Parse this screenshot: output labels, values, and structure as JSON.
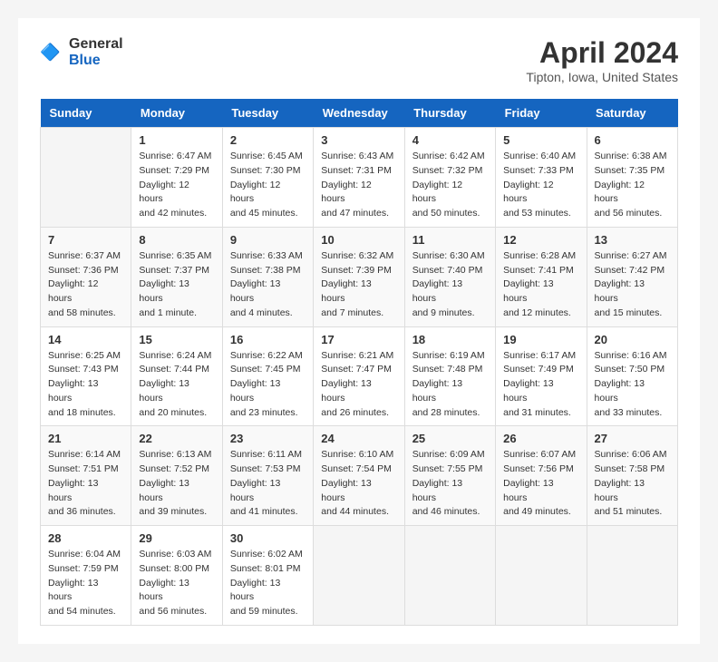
{
  "header": {
    "logo_general": "General",
    "logo_blue": "Blue",
    "title": "April 2024",
    "subtitle": "Tipton, Iowa, United States"
  },
  "days_of_week": [
    "Sunday",
    "Monday",
    "Tuesday",
    "Wednesday",
    "Thursday",
    "Friday",
    "Saturday"
  ],
  "weeks": [
    [
      {
        "day": "",
        "info": ""
      },
      {
        "day": "1",
        "info": "Sunrise: 6:47 AM\nSunset: 7:29 PM\nDaylight: 12 hours\nand 42 minutes."
      },
      {
        "day": "2",
        "info": "Sunrise: 6:45 AM\nSunset: 7:30 PM\nDaylight: 12 hours\nand 45 minutes."
      },
      {
        "day": "3",
        "info": "Sunrise: 6:43 AM\nSunset: 7:31 PM\nDaylight: 12 hours\nand 47 minutes."
      },
      {
        "day": "4",
        "info": "Sunrise: 6:42 AM\nSunset: 7:32 PM\nDaylight: 12 hours\nand 50 minutes."
      },
      {
        "day": "5",
        "info": "Sunrise: 6:40 AM\nSunset: 7:33 PM\nDaylight: 12 hours\nand 53 minutes."
      },
      {
        "day": "6",
        "info": "Sunrise: 6:38 AM\nSunset: 7:35 PM\nDaylight: 12 hours\nand 56 minutes."
      }
    ],
    [
      {
        "day": "7",
        "info": "Sunrise: 6:37 AM\nSunset: 7:36 PM\nDaylight: 12 hours\nand 58 minutes."
      },
      {
        "day": "8",
        "info": "Sunrise: 6:35 AM\nSunset: 7:37 PM\nDaylight: 13 hours\nand 1 minute."
      },
      {
        "day": "9",
        "info": "Sunrise: 6:33 AM\nSunset: 7:38 PM\nDaylight: 13 hours\nand 4 minutes."
      },
      {
        "day": "10",
        "info": "Sunrise: 6:32 AM\nSunset: 7:39 PM\nDaylight: 13 hours\nand 7 minutes."
      },
      {
        "day": "11",
        "info": "Sunrise: 6:30 AM\nSunset: 7:40 PM\nDaylight: 13 hours\nand 9 minutes."
      },
      {
        "day": "12",
        "info": "Sunrise: 6:28 AM\nSunset: 7:41 PM\nDaylight: 13 hours\nand 12 minutes."
      },
      {
        "day": "13",
        "info": "Sunrise: 6:27 AM\nSunset: 7:42 PM\nDaylight: 13 hours\nand 15 minutes."
      }
    ],
    [
      {
        "day": "14",
        "info": "Sunrise: 6:25 AM\nSunset: 7:43 PM\nDaylight: 13 hours\nand 18 minutes."
      },
      {
        "day": "15",
        "info": "Sunrise: 6:24 AM\nSunset: 7:44 PM\nDaylight: 13 hours\nand 20 minutes."
      },
      {
        "day": "16",
        "info": "Sunrise: 6:22 AM\nSunset: 7:45 PM\nDaylight: 13 hours\nand 23 minutes."
      },
      {
        "day": "17",
        "info": "Sunrise: 6:21 AM\nSunset: 7:47 PM\nDaylight: 13 hours\nand 26 minutes."
      },
      {
        "day": "18",
        "info": "Sunrise: 6:19 AM\nSunset: 7:48 PM\nDaylight: 13 hours\nand 28 minutes."
      },
      {
        "day": "19",
        "info": "Sunrise: 6:17 AM\nSunset: 7:49 PM\nDaylight: 13 hours\nand 31 minutes."
      },
      {
        "day": "20",
        "info": "Sunrise: 6:16 AM\nSunset: 7:50 PM\nDaylight: 13 hours\nand 33 minutes."
      }
    ],
    [
      {
        "day": "21",
        "info": "Sunrise: 6:14 AM\nSunset: 7:51 PM\nDaylight: 13 hours\nand 36 minutes."
      },
      {
        "day": "22",
        "info": "Sunrise: 6:13 AM\nSunset: 7:52 PM\nDaylight: 13 hours\nand 39 minutes."
      },
      {
        "day": "23",
        "info": "Sunrise: 6:11 AM\nSunset: 7:53 PM\nDaylight: 13 hours\nand 41 minutes."
      },
      {
        "day": "24",
        "info": "Sunrise: 6:10 AM\nSunset: 7:54 PM\nDaylight: 13 hours\nand 44 minutes."
      },
      {
        "day": "25",
        "info": "Sunrise: 6:09 AM\nSunset: 7:55 PM\nDaylight: 13 hours\nand 46 minutes."
      },
      {
        "day": "26",
        "info": "Sunrise: 6:07 AM\nSunset: 7:56 PM\nDaylight: 13 hours\nand 49 minutes."
      },
      {
        "day": "27",
        "info": "Sunrise: 6:06 AM\nSunset: 7:58 PM\nDaylight: 13 hours\nand 51 minutes."
      }
    ],
    [
      {
        "day": "28",
        "info": "Sunrise: 6:04 AM\nSunset: 7:59 PM\nDaylight: 13 hours\nand 54 minutes."
      },
      {
        "day": "29",
        "info": "Sunrise: 6:03 AM\nSunset: 8:00 PM\nDaylight: 13 hours\nand 56 minutes."
      },
      {
        "day": "30",
        "info": "Sunrise: 6:02 AM\nSunset: 8:01 PM\nDaylight: 13 hours\nand 59 minutes."
      },
      {
        "day": "",
        "info": ""
      },
      {
        "day": "",
        "info": ""
      },
      {
        "day": "",
        "info": ""
      },
      {
        "day": "",
        "info": ""
      }
    ]
  ]
}
